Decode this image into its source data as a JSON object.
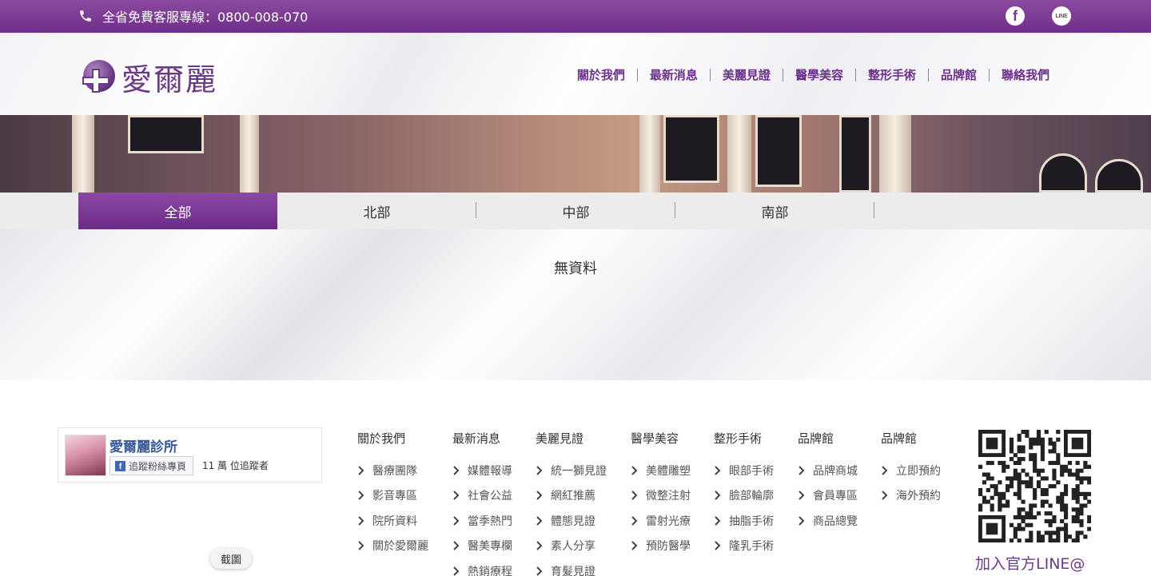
{
  "topbar": {
    "hotline": "全省免費客服專線：0800-008-070",
    "social": [
      {
        "icon": "facebook-icon",
        "glyph": "f"
      },
      {
        "icon": "line-icon",
        "glyph": "LINE"
      }
    ]
  },
  "header": {
    "logo_text": "愛爾麗",
    "nav": [
      "關於我們",
      "最新消息",
      "美麗見證",
      "醫學美容",
      "整形手術",
      "品牌館",
      "聯絡我們"
    ]
  },
  "tabs": [
    "全部",
    "北部",
    "中部",
    "南部"
  ],
  "active_tab": "全部",
  "content": {
    "empty_message": "無資料"
  },
  "facebook": {
    "page_name": "愛爾麗診所",
    "follow_label": "追蹤粉絲專頁",
    "follow_glyph": "f",
    "followers": "11 萬 位追蹤者"
  },
  "footer_columns": [
    {
      "title": "關於我們",
      "links": [
        "醫療團隊",
        "影音專區",
        "院所資料",
        "關於愛爾麗"
      ]
    },
    {
      "title": "最新消息",
      "links": [
        "媒體報導",
        "社會公益",
        "當季熱門",
        "醫美專欄",
        "熱銷療程"
      ]
    },
    {
      "title": "美麗見證",
      "links": [
        "統一獅見證",
        "網紅推薦",
        "體態見證",
        "素人分享",
        "育髮見證"
      ]
    },
    {
      "title": "醫學美容",
      "links": [
        "美體雕塑",
        "微整注射",
        "雷射光療",
        "預防醫學"
      ]
    },
    {
      "title": "整形手術",
      "links": [
        "眼部手術",
        "臉部輪廓",
        "抽脂手術",
        "隆乳手術"
      ]
    },
    {
      "title": "品牌館",
      "links": [
        "品牌商城",
        "會員專區",
        "商品總覽"
      ]
    },
    {
      "title": "品牌館",
      "links": [
        "立即預約",
        "海外預約"
      ]
    }
  ],
  "qr_label": "加入官方LINE@",
  "tooltip": "截圖",
  "colors": {
    "brand_purple": "#6f2f8a",
    "nav_text": "#6c2f8a",
    "fb_blue": "#365899"
  }
}
